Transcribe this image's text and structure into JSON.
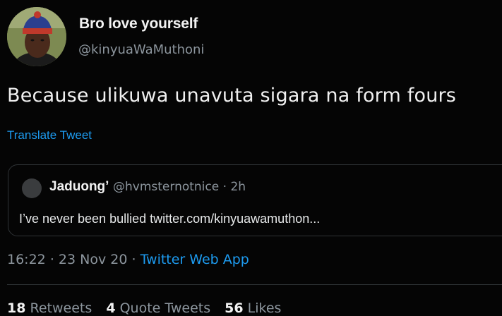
{
  "tweet": {
    "author": {
      "display_name": "Bro love yourself",
      "handle": "@kinyuaWaMuthoni"
    },
    "text": "Because ulikuwa unavuta sigara na form fours",
    "translate_label": "Translate Tweet",
    "quoted": {
      "display_name": "Jaduong’",
      "handle": "@hvmsternotnice",
      "separator": "·",
      "time_ago": "2h",
      "text": "I’ve never been bullied twitter.com/kinyuawamuthon..."
    },
    "timestamp": {
      "time": "16:22",
      "sep1": "·",
      "date": "23 Nov 20",
      "sep2": "·",
      "source": "Twitter Web App"
    },
    "stats": {
      "retweets_count": "18",
      "retweets_label": "Retweets",
      "quotes_count": "4",
      "quotes_label": "Quote Tweets",
      "likes_count": "56",
      "likes_label": "Likes"
    }
  },
  "colors": {
    "background": "#050505",
    "link": "#1d9bf0",
    "muted": "#8d969e",
    "border": "#2f3336"
  }
}
